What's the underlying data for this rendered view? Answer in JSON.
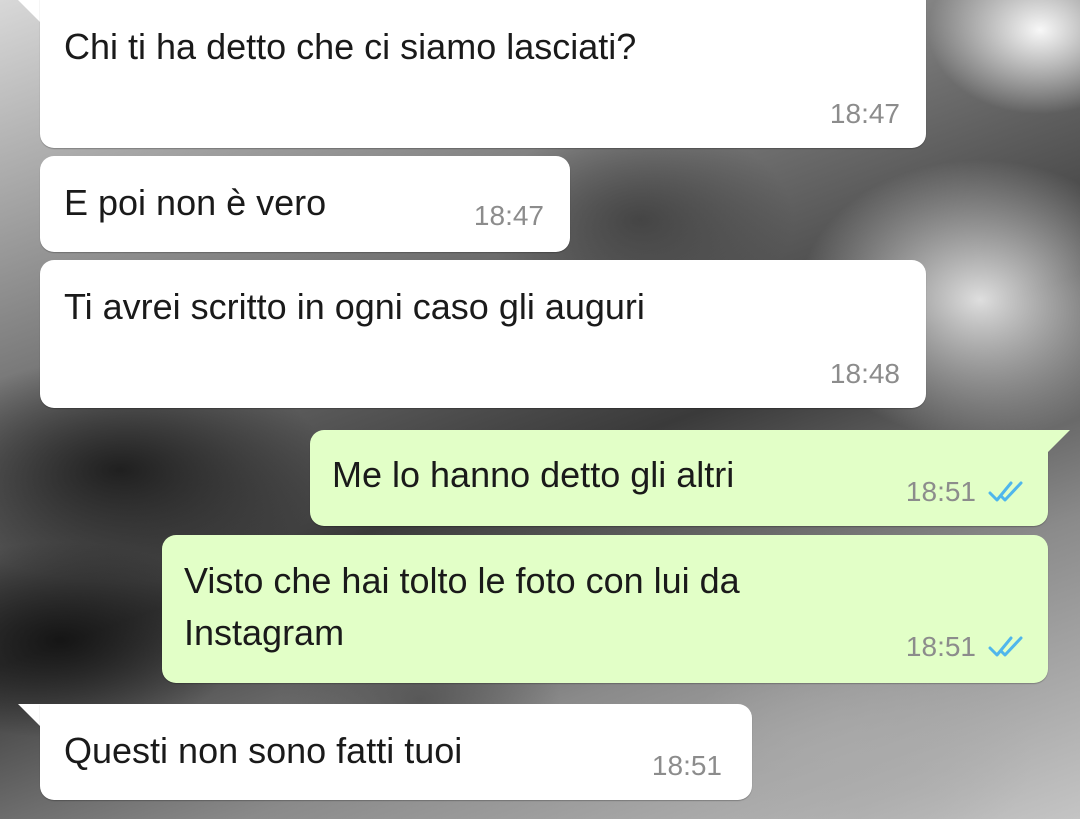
{
  "messages": [
    {
      "direction": "incoming",
      "text": "Chi ti ha detto che ci siamo lasciati?",
      "time": "18:47"
    },
    {
      "direction": "incoming",
      "text": "E poi non è vero",
      "time": "18:47"
    },
    {
      "direction": "incoming",
      "text": "Ti avrei scritto in ogni caso gli auguri",
      "time": "18:48"
    },
    {
      "direction": "outgoing",
      "text": "Me lo hanno detto gli altri",
      "time": "18:51",
      "status": "read",
      "status_icon": "double-check-icon"
    },
    {
      "direction": "outgoing",
      "text_lines": [
        "Visto che hai tolto le foto con lui da",
        "Instagram"
      ],
      "time": "18:51",
      "status": "read",
      "status_icon": "double-check-icon"
    },
    {
      "direction": "incoming",
      "text": "Questi non sono fatti tuoi",
      "time": "18:51"
    }
  ],
  "colors": {
    "incoming_bubble": "#ffffff",
    "outgoing_bubble": "#e2ffc7",
    "timestamp": "#8c8c8c",
    "read_ticks": "#4fb6ec"
  }
}
